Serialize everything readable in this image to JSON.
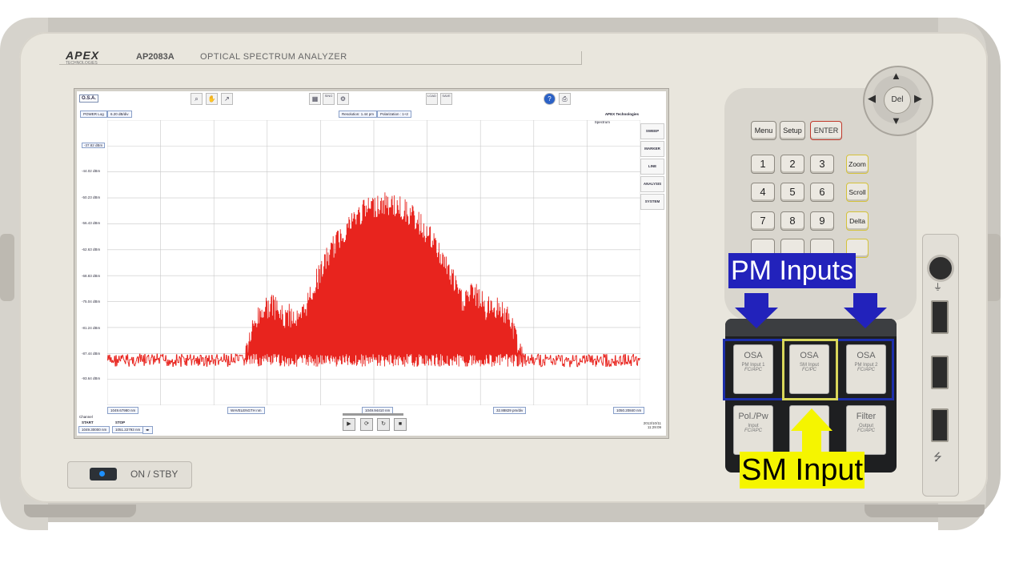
{
  "device": {
    "brand": "APEX",
    "brand_sub": "TECHNOLOGIES",
    "model": "AP2083A",
    "name": "OPTICAL SPECTRUM ANALYZER",
    "power_label": "ON / STBY"
  },
  "screen": {
    "mode": "O.S.A.",
    "scale_label": "POWER Log",
    "scale_value": "6.20 dB/div",
    "resolution": "Resolution: 1.44 pm",
    "polarization": "Polarization : 1+2",
    "vendor": "APEX Technologies",
    "trace_name": "Spectrum",
    "side_menu": [
      "SWEEP",
      "MARKER",
      "LINE",
      "ANALYSIS",
      "SYSTEM"
    ],
    "toolbar": {
      "load": "LOAD",
      "save": "SAVE",
      "single": "SING"
    },
    "y_ticks": [
      "-37.82 dBm",
      "-44.02 dBm",
      "-50.23 dBm",
      "-56.43 dBm",
      "-62.63 dBm",
      "-68.83 dBm",
      "-75.04 dBm",
      "-81.24 dBm",
      "-87.44 dBm",
      "-93.64 dBm"
    ],
    "x_start": "1049.67980 nm",
    "x_axis_label": "WAVELENGTH nm",
    "x_center": "1049.94410 nm",
    "x_span": "32.88829 pm/div",
    "x_stop": "1050.20840 nm",
    "channel_label": "Channel",
    "start_label": "START",
    "stop_label": "STOP",
    "start_value": "1049.30000 nm",
    "stop_value": "1051.22793 nm",
    "date": "2013/10/11",
    "time": "11:29:09"
  },
  "keypad": {
    "dpad_center": "Del",
    "menu": "Menu",
    "setup": "Setup",
    "enter": "ENTER",
    "digits": [
      "1",
      "2",
      "3",
      "4",
      "5",
      "6",
      "7",
      "8",
      "9"
    ],
    "zoom": "Zoom",
    "scroll": "Scroll",
    "delta": "Delta"
  },
  "connectors": [
    {
      "title": "OSA",
      "sub": "PM Input 1",
      "type": "FC/APC"
    },
    {
      "title": "OSA",
      "sub": "SM Input",
      "type": "FC/PC"
    },
    {
      "title": "OSA",
      "sub": "PM Input 2",
      "type": "FC/APC"
    },
    {
      "title": "Pol./Pw",
      "sub": "Input",
      "type": "FC/APC"
    },
    {
      "title": "Filter",
      "sub": "Output",
      "type": "FC/APC"
    }
  ],
  "callouts": {
    "pm_inputs": "PM Inputs",
    "sm_input": "SM Input",
    "pm_color": "#2222bb",
    "sm_color": "#f5f500"
  },
  "colors": {
    "trace": "#e8241e",
    "grid": "#c8c8c8"
  }
}
